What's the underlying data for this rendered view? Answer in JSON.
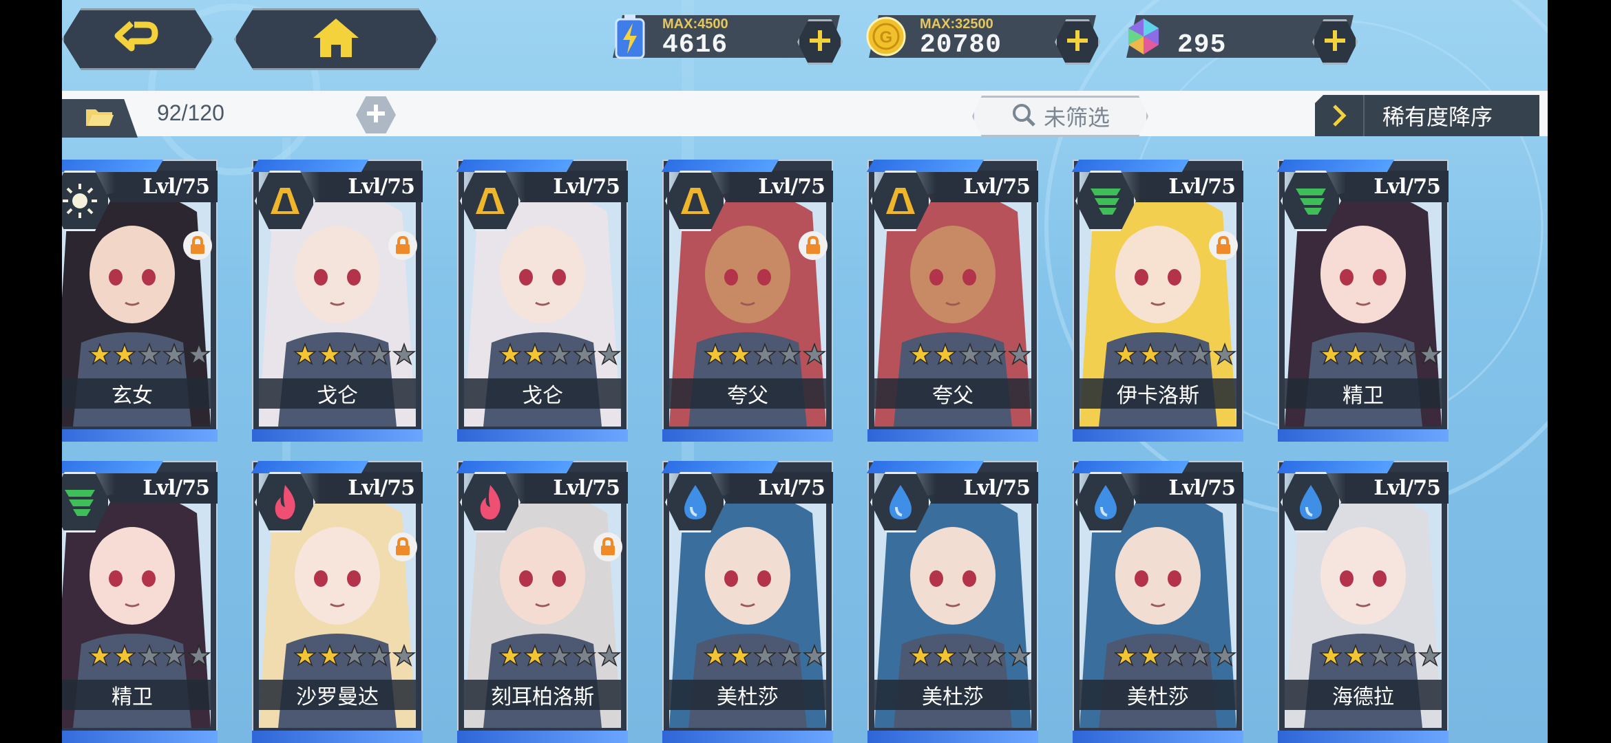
{
  "topbar": {
    "energy": {
      "max": "MAX:4500",
      "value": "4616"
    },
    "gold": {
      "max": "MAX:32500",
      "value": "20780"
    },
    "gems": {
      "value": "295"
    }
  },
  "inventory": {
    "count": "92/120",
    "filter": "未筛选",
    "sort": "稀有度降序"
  },
  "cards": [
    {
      "name": "玄女",
      "level": "Lvl/75",
      "element": "light",
      "locked": true,
      "stars": 2,
      "hair": "#2b2630",
      "skin": "#f2d6c8"
    },
    {
      "name": "戈仑",
      "level": "Lvl/75",
      "element": "earth",
      "locked": true,
      "stars": 2,
      "hair": "#e9e4ea",
      "skin": "#f5e4dc"
    },
    {
      "name": "戈仑",
      "level": "Lvl/75",
      "element": "earth",
      "locked": false,
      "stars": 2,
      "hair": "#e9e4ea",
      "skin": "#f5e4dc"
    },
    {
      "name": "夸父",
      "level": "Lvl/75",
      "element": "earth",
      "locked": true,
      "stars": 2,
      "hair": "#b8525a",
      "skin": "#c78a64"
    },
    {
      "name": "夸父",
      "level": "Lvl/75",
      "element": "earth",
      "locked": false,
      "stars": 2,
      "hair": "#b8525a",
      "skin": "#c78a64"
    },
    {
      "name": "伊卡洛斯",
      "level": "Lvl/75",
      "element": "wind",
      "locked": true,
      "stars": 2,
      "hair": "#f2cf4e",
      "skin": "#f7e2d2"
    },
    {
      "name": "精卫",
      "level": "Lvl/75",
      "element": "wind",
      "locked": false,
      "stars": 2,
      "hair": "#3a2a3c",
      "skin": "#f6dcd4"
    },
    {
      "name": "精卫",
      "level": "Lvl/75",
      "element": "wind",
      "locked": false,
      "stars": 2,
      "hair": "#3a2a3c",
      "skin": "#f6dcd4"
    },
    {
      "name": "沙罗曼达",
      "level": "Lvl/75",
      "element": "fire",
      "locked": true,
      "stars": 2,
      "hair": "#f1dcb0",
      "skin": "#f7e4da"
    },
    {
      "name": "刻耳柏洛斯",
      "level": "Lvl/75",
      "element": "fire",
      "locked": true,
      "stars": 2,
      "hair": "#d8d6d6",
      "skin": "#f5dcd2"
    },
    {
      "name": "美杜莎",
      "level": "Lvl/75",
      "element": "water",
      "locked": false,
      "stars": 2,
      "hair": "#3a6e9c",
      "skin": "#f2ddd2"
    },
    {
      "name": "美杜莎",
      "level": "Lvl/75",
      "element": "water",
      "locked": false,
      "stars": 2,
      "hair": "#3a6e9c",
      "skin": "#f2ddd2"
    },
    {
      "name": "美杜莎",
      "level": "Lvl/75",
      "element": "water",
      "locked": false,
      "stars": 2,
      "hair": "#3a6e9c",
      "skin": "#f2ddd2"
    },
    {
      "name": "海德拉",
      "level": "Lvl/75",
      "element": "water",
      "locked": false,
      "stars": 2,
      "hair": "#dcdde2",
      "skin": "#f6e4de"
    }
  ],
  "colors": {
    "element_light": "#f4f0dc",
    "element_earth": "#f0b62b",
    "element_wind": "#3fbd58",
    "element_fire": "#ef4f73",
    "element_water": "#3f8fe6",
    "star_on": "#f4c532",
    "star_off": "#7b838c"
  }
}
